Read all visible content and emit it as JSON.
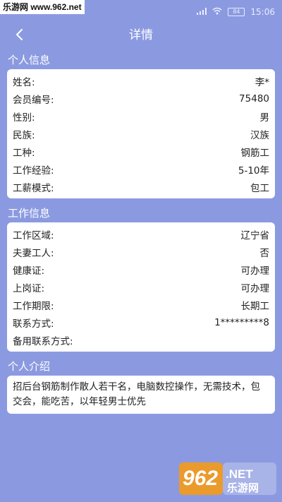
{
  "status_bar": {
    "watermark": "乐游网 www.962.net",
    "time": "15:06",
    "battery": "84"
  },
  "header": {
    "back_icon": "chevron-left-icon",
    "title": "详情"
  },
  "personal": {
    "title": "个人信息",
    "rows": [
      {
        "label": "姓名:",
        "value": "李*"
      },
      {
        "label": "会员编号:",
        "value": "75480"
      },
      {
        "label": "性别:",
        "value": "男"
      },
      {
        "label": "民族:",
        "value": "汉族"
      },
      {
        "label": "工种:",
        "value": "钢筋工"
      },
      {
        "label": "工作经验:",
        "value": "5-10年"
      },
      {
        "label": "工薪模式:",
        "value": "包工"
      }
    ]
  },
  "work": {
    "title": "工作信息",
    "rows": [
      {
        "label": "工作区域:",
        "value": "辽宁省"
      },
      {
        "label": "夫妻工人:",
        "value": "否"
      },
      {
        "label": "健康证:",
        "value": "可办理"
      },
      {
        "label": "上岗证:",
        "value": "可办理"
      },
      {
        "label": "工作期限:",
        "value": "长期工"
      },
      {
        "label": "联系方式:",
        "value": "1*********8"
      },
      {
        "label": "备用联系方式:",
        "value": ""
      }
    ]
  },
  "intro": {
    "title": "个人介绍",
    "text": "招后台钢筋制作散人若干名，电脑数控操作，无需技术，包交会，能吃苦，以年轻男士优先"
  },
  "logo": {
    "number": "962",
    "suffix": ".NET",
    "name": "乐游网"
  },
  "colors": {
    "background": "#8b9ae0",
    "card": "#ffffff",
    "logo_orange": "#f39a1c"
  }
}
